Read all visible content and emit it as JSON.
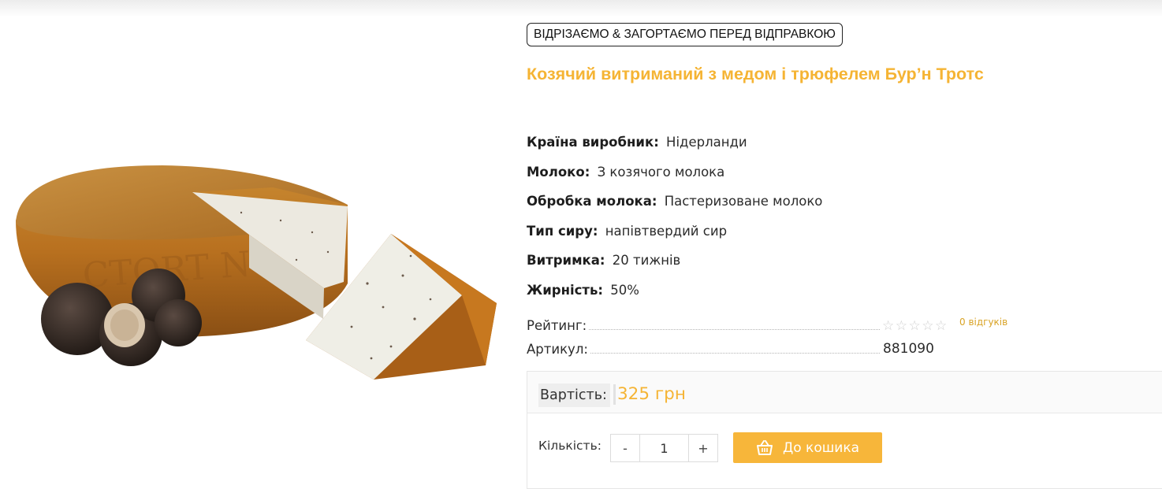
{
  "badge": "ВІДРІЗАЄМО & ЗАГОРТАЄМО  ПЕРЕД  ВІДПРАВКОЮ",
  "product": {
    "title": "Козячий витриманий з медом і трюфелем Бур’н Тротс",
    "image_alt": "product-image-cheese-with-truffle",
    "attributes": [
      {
        "label": "Країна виробник:",
        "value": "Нідерланди"
      },
      {
        "label": "Молоко:",
        "value": "З козячого молока"
      },
      {
        "label": "Обробка молока:",
        "value": "Пастеризоване молоко"
      },
      {
        "label": "Тип сиру:",
        "value": "напівтвердий сир"
      },
      {
        "label": "Витримка:",
        "value": "20 тижнів"
      },
      {
        "label": "Жирність:",
        "value": "50%"
      }
    ],
    "rating": {
      "label": "Рейтинг:",
      "stars": "☆☆☆☆☆",
      "value": 0,
      "max": 5,
      "reviews": "0 відгуків"
    },
    "sku": {
      "label": "Артикул:",
      "value": "881090"
    }
  },
  "purchase": {
    "price_label": "Вартість:",
    "price": "325 грн",
    "qty_label": "Кількість:",
    "minus": "-",
    "plus": "+",
    "qty_value": "1",
    "cart_label": "До кошика",
    "cart_icon": "basket-icon"
  },
  "colors": {
    "accent": "#f5b434",
    "button": "#f7b63a",
    "text": "#222222"
  }
}
